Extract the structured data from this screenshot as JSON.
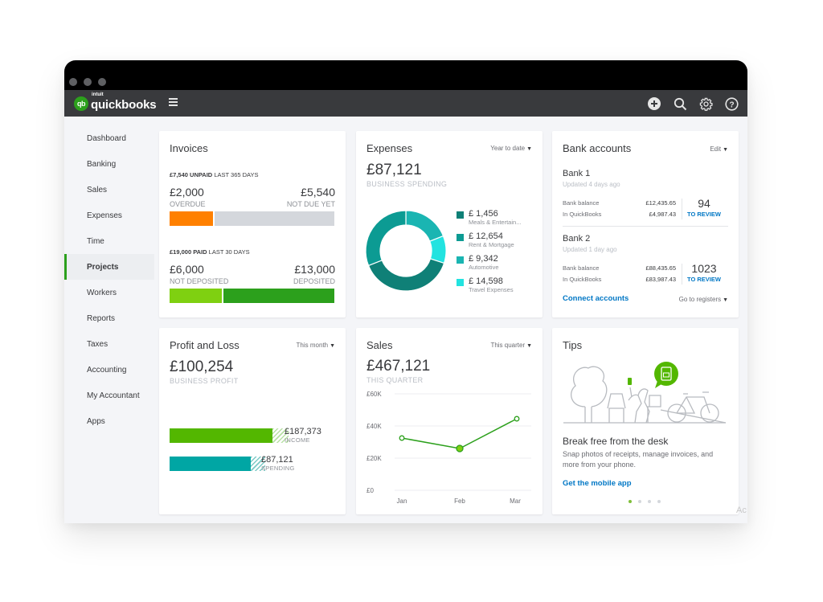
{
  "app": {
    "brand_top": "intuit",
    "brand_name": "quickbooks",
    "brand_badge": "qb"
  },
  "navbar": {
    "icons": [
      "plus-circle-icon",
      "search-icon",
      "gear-icon",
      "help-icon"
    ]
  },
  "sidebar": {
    "active": "Projects",
    "items": [
      {
        "label": "Dashboard"
      },
      {
        "label": "Banking"
      },
      {
        "label": "Sales"
      },
      {
        "label": "Expenses"
      },
      {
        "label": "Time"
      },
      {
        "label": "Projects"
      },
      {
        "label": "Workers"
      },
      {
        "label": "Reports"
      },
      {
        "label": "Taxes"
      },
      {
        "label": "Accounting"
      },
      {
        "label": "My Accountant"
      },
      {
        "label": "Apps"
      }
    ]
  },
  "invoices": {
    "title": "Invoices",
    "unpaid_amount": "£7,540 UNPAID",
    "unpaid_period": "LAST 365 DAYS",
    "overdue_amount": "£2,000",
    "overdue_label": "OVERDUE",
    "not_due_amount": "£5,540",
    "not_due_label": "NOT DUE YET",
    "overdue_fraction": 0.265,
    "paid_amount": "£19,000 PAID",
    "paid_period": "LAST 30 DAYS",
    "not_deposited_amount": "£6,000",
    "not_deposited_label": "NOT DEPOSITED",
    "deposited_amount": "£13,000",
    "deposited_label": "DEPOSITED",
    "not_deposited_fraction": 0.316,
    "colors": {
      "overdue": "#ff8000",
      "not_due": "#d4d7dc",
      "not_deposited": "#7fd011",
      "deposited": "#2ca01c"
    }
  },
  "expenses": {
    "title": "Expenses",
    "period": "Year to date",
    "total": "£87,121",
    "total_label": "BUSINESS SPENDING",
    "legend": [
      {
        "amount": "£ 1,456",
        "label": "Meals & Entertain...",
        "color": "#0f8077"
      },
      {
        "amount": "£ 12,654",
        "label": "Rent & Mortgage",
        "color": "#0c9b93"
      },
      {
        "amount": "£ 9,342",
        "label": "Automotive",
        "color": "#1ab5b2"
      },
      {
        "amount": "£ 14,598",
        "label": "Travel Expenses",
        "color": "#22e3e0"
      }
    ]
  },
  "chart_data": {
    "type": "pie",
    "title": "Expenses",
    "subtitle": "BUSINESS SPENDING",
    "note": "donut chart; visual slice proportions (clockwise from top)",
    "slices": [
      {
        "label": "Automotive",
        "value": 19,
        "color": "#1ab5b2"
      },
      {
        "label": "Travel Expenses",
        "value": 11,
        "color": "#22e3e0"
      },
      {
        "label": "Meals & Entertain...",
        "value": 39,
        "color": "#0f8077"
      },
      {
        "label": "Rent & Mortgage",
        "value": 31,
        "color": "#0c9b93"
      }
    ]
  },
  "sales_chart": {
    "type": "line",
    "title": "Sales",
    "categories": [
      "Jan",
      "Feb",
      "Mar"
    ],
    "series": [
      {
        "name": "Sales",
        "values": [
          32500,
          26000,
          44500
        ]
      }
    ],
    "y_ticks": [
      "£0",
      "£20K",
      "£40K",
      "£60K"
    ],
    "ylim": [
      0,
      60000
    ],
    "grid": true,
    "color": "#2ca01c"
  },
  "bank": {
    "title": "Bank accounts",
    "edit_label": "Edit",
    "accounts": [
      {
        "name": "Bank 1",
        "updated": "Updated 4 days ago",
        "balance_label": "Bank balance",
        "balance": "£12,435.65",
        "qb_label": "In QuickBooks",
        "qb": "£4,987.43",
        "count": "94",
        "review": "TO REVIEW"
      },
      {
        "name": "Bank 2",
        "updated": "Updated 1 day ago",
        "balance_label": "Bank balance",
        "balance": "£88,435.65",
        "qb_label": "In QuickBooks",
        "qb": "£83,987.43",
        "count": "1023",
        "review": "TO REVIEW"
      }
    ],
    "connect_label": "Connect accounts",
    "registers_label": "Go to registers"
  },
  "pl": {
    "title": "Profit and Loss",
    "period": "This month",
    "total": "£100,254",
    "total_label": "BUSINESS PROFIT",
    "income_amount": "£187,373",
    "income_label": "INCOME",
    "spending_amount": "£87,121",
    "spending_label": "SPENDING",
    "colors": {
      "income": "#53b700",
      "spending": "#00a6a4"
    }
  },
  "sales": {
    "title": "Sales",
    "period": "This quarter",
    "total": "£467,121",
    "total_label": "THIS QUARTER"
  },
  "tips": {
    "title": "Tips",
    "headline": "Break free from the desk",
    "body": "Snap photos of receipts, manage invoices, and more from your phone.",
    "link": "Get the mobile app",
    "page_count": 4,
    "active_page": 1
  },
  "watermark": "Ac"
}
